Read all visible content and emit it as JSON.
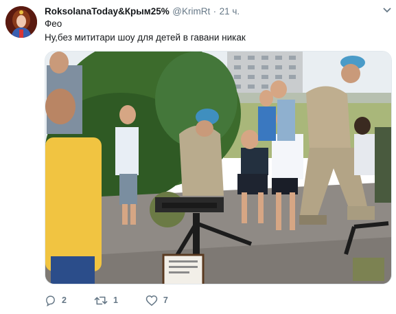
{
  "tweet": {
    "display_name": "RoksolanaToday&Крым25%",
    "handle": "@KrimRt",
    "separator": "·",
    "time": "21 ч.",
    "text_line1": "Фео",
    "text_line2": "Ну,без мититари шоу для детей в гавани никак"
  },
  "actions": {
    "reply_count": "2",
    "retweet_count": "1",
    "like_count": "7"
  },
  "icons": {
    "avatar": "avatar-portrait",
    "more": "chevron-down-icon",
    "reply": "reply-icon",
    "retweet": "retweet-icon",
    "like": "heart-icon"
  },
  "colors": {
    "text": "#14171a",
    "secondary": "#657786",
    "border": "#e1e8ed"
  }
}
